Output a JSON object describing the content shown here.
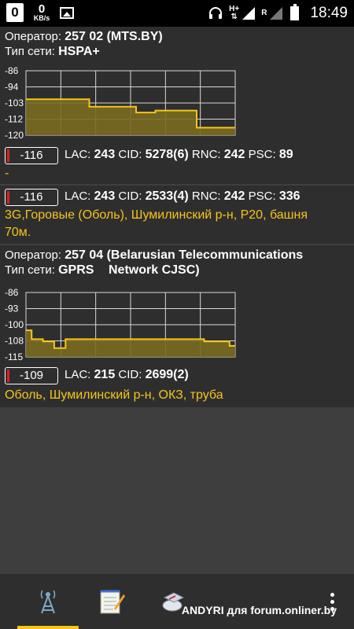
{
  "status_bar": {
    "notif_count": "0",
    "speed_value": "0",
    "speed_unit": "KB/s",
    "network_badge": "H+",
    "roaming_badge": "R",
    "time": "18:49"
  },
  "cells": [
    {
      "operator_label": "Оператор:",
      "operator_value": "257 02 (MTS.BY)",
      "network_label": "Тип сети:",
      "network_value": "HSPA+",
      "chart": {
        "y_ticks": [
          "-86",
          "-94",
          "-103",
          "-112",
          "-120"
        ],
        "ylim": [
          -120,
          -86
        ],
        "values": [
          -101,
          -101,
          -101,
          -101,
          -101,
          -101,
          -101,
          -101,
          -101,
          -101,
          -101,
          -101,
          -101,
          -101,
          -101,
          -101,
          -101,
          -101,
          -101,
          -101,
          -101,
          -101,
          -101,
          -105,
          -105,
          -105,
          -105,
          -105,
          -105,
          -105,
          -105,
          -105,
          -105,
          -105,
          -105,
          -105,
          -105,
          -105,
          -105,
          -105,
          -108,
          -108,
          -108,
          -108,
          -108,
          -108,
          -108,
          -107,
          -107,
          -107,
          -107,
          -107,
          -107,
          -107,
          -107,
          -107,
          -107,
          -107,
          -107,
          -107,
          -107,
          -107,
          -116,
          -116,
          -116,
          -116,
          -116,
          -116,
          -116,
          -116,
          -116,
          -116,
          -116,
          -116,
          -116,
          -116
        ]
      },
      "signal": "-116",
      "lac_label": "LAC:",
      "lac": "243",
      "cid_label": "CID:",
      "cid": "5278(6)",
      "rnc_label": "RNC:",
      "rnc": "242",
      "psc_label": "PSC:",
      "psc": "89",
      "location": "-"
    },
    {
      "signal": "-116",
      "lac_label": "LAC:",
      "lac": "243",
      "cid_label": "CID:",
      "cid": "2533(4)",
      "rnc_label": "RNC:",
      "rnc": "242",
      "psc_label": "PSC:",
      "psc": "336",
      "location_line1": "3G,Горовые (Оболь), Шумилинский р-н, Р20, башня",
      "location_line2": "70м."
    },
    {
      "operator_label": "Оператор:",
      "operator_value": "257 04 (Belarusian Telecommunications",
      "network_label": "Тип сети:",
      "network_value": "GPRS",
      "operator_value_cont": "Network CJSC)",
      "chart": {
        "y_ticks": [
          "-86",
          "-93",
          "-100",
          "-108",
          "-115"
        ],
        "ylim": [
          -115,
          -86
        ],
        "values": [
          -103,
          -103,
          -107,
          -107,
          -107,
          -107,
          -108,
          -108,
          -108,
          -108,
          -111,
          -111,
          -111,
          -111,
          -107,
          -107,
          -107,
          -107,
          -107,
          -107,
          -107,
          -107,
          -107,
          -107,
          -107,
          -107,
          -107,
          -107,
          -107,
          -107,
          -107,
          -107,
          -107,
          -107,
          -107,
          -107,
          -107,
          -107,
          -107,
          -107,
          -107,
          -107,
          -107,
          -107,
          -107,
          -107,
          -107,
          -107,
          -107,
          -107,
          -107,
          -107,
          -107,
          -107,
          -107,
          -107,
          -107,
          -107,
          -107,
          -107,
          -107,
          -107,
          -107,
          -108,
          -108,
          -108,
          -108,
          -108,
          -108,
          -108,
          -108,
          -108,
          -110,
          -110
        ]
      },
      "signal": "-109",
      "lac_label": "LAC:",
      "lac": "215",
      "cid_label": "CID:",
      "cid": "2699(2)",
      "location": "Оболь, Шумилинский р-н, ОКЗ, труба"
    }
  ],
  "bottom_bar": {
    "tabs": [
      "cell-tower-icon",
      "notepad-icon",
      "compass-icon"
    ],
    "menu": "overflow-menu-icon",
    "watermark": "ANDYRI для forum.onliner.by"
  },
  "colors": {
    "accent": "#f5c518",
    "signal_marker": "#e02020",
    "chart_fill": "#7a6a20",
    "chart_line": "#f5c518"
  }
}
